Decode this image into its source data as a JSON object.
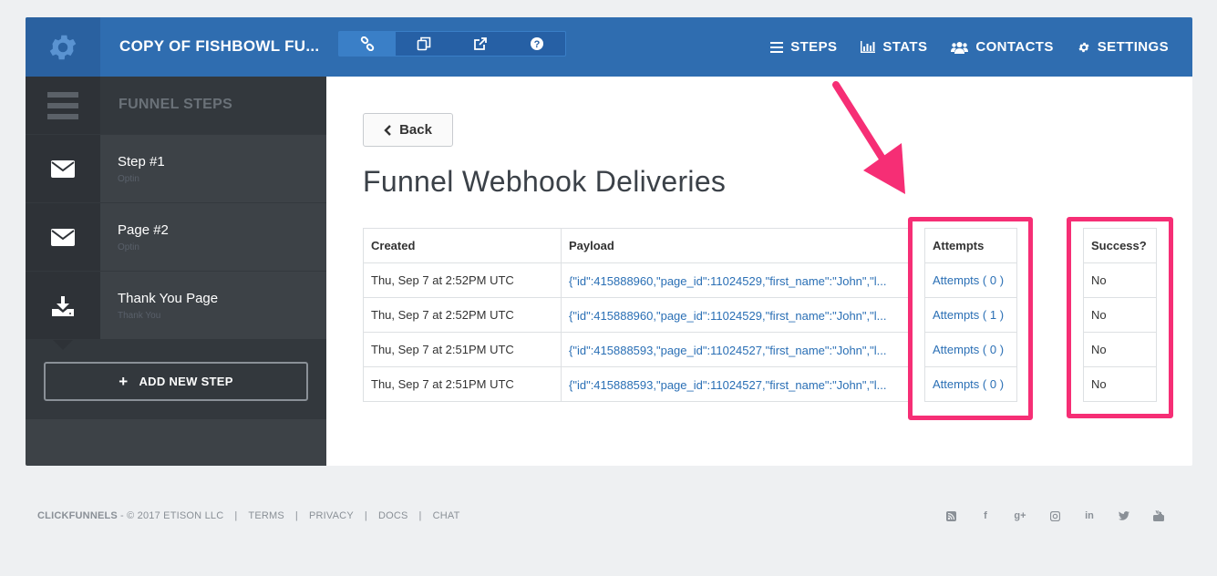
{
  "header": {
    "title": "COPY OF FISHBOWL FU...",
    "nav": [
      {
        "label": "STEPS",
        "icon": "list-icon"
      },
      {
        "label": "STATS",
        "icon": "bar-chart-icon"
      },
      {
        "label": "CONTACTS",
        "icon": "users-icon"
      },
      {
        "label": "SETTINGS",
        "icon": "gear-icon"
      }
    ]
  },
  "sidebar": {
    "heading": "FUNNEL STEPS",
    "steps": [
      {
        "name": "Step #1",
        "sub": "Optin",
        "icon": "envelope-icon"
      },
      {
        "name": "Page #2",
        "sub": "Optin",
        "icon": "envelope-icon"
      },
      {
        "name": "Thank You Page",
        "sub": "Thank You",
        "icon": "download-icon"
      }
    ],
    "add_label": "ADD NEW STEP"
  },
  "main": {
    "back_label": "Back",
    "title": "Funnel Webhook Deliveries",
    "columns": {
      "created": "Created",
      "payload": "Payload",
      "attempts": "Attempts",
      "success": "Success?"
    },
    "rows": [
      {
        "created": "Thu, Sep 7 at 2:52PM UTC",
        "payload": "{\"id\":415888960,\"page_id\":11024529,\"first_name\":\"John\",\"l...",
        "attempts": "Attempts ( 0 )",
        "success": "No"
      },
      {
        "created": "Thu, Sep 7 at 2:52PM UTC",
        "payload": "{\"id\":415888960,\"page_id\":11024529,\"first_name\":\"John\",\"l...",
        "attempts": "Attempts ( 1 )",
        "success": "No"
      },
      {
        "created": "Thu, Sep 7 at 2:51PM UTC",
        "payload": "{\"id\":415888593,\"page_id\":11024527,\"first_name\":\"John\",\"l...",
        "attempts": "Attempts ( 0 )",
        "success": "No"
      },
      {
        "created": "Thu, Sep 7 at 2:51PM UTC",
        "payload": "{\"id\":415888593,\"page_id\":11024527,\"first_name\":\"John\",\"l...",
        "attempts": "Attempts ( 0 )",
        "success": "No"
      }
    ]
  },
  "footer": {
    "brand": "CLICKFUNNELS",
    "copyright": "- © 2017 ETISON LLC",
    "links": [
      "TERMS",
      "PRIVACY",
      "DOCS",
      "CHAT"
    ]
  },
  "colors": {
    "header": "#2f6db0",
    "sidebar": "#3d4247",
    "highlight": "#f62e75",
    "link": "#2a6fb5"
  }
}
